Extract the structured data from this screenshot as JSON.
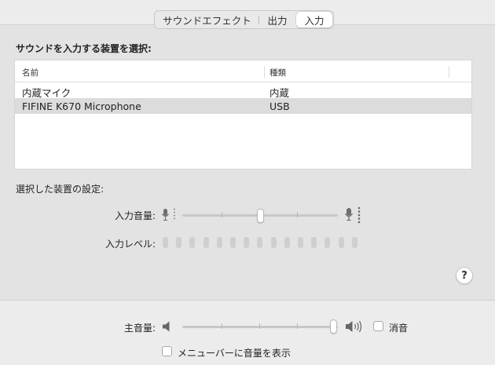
{
  "tabs": [
    {
      "label": "サウンドエフェクト",
      "active": false
    },
    {
      "label": "出力",
      "active": false
    },
    {
      "label": "入力",
      "active": true
    }
  ],
  "input": {
    "section_title": "サウンドを入力する装置を選択:",
    "table": {
      "columns": [
        "名前",
        "種類"
      ],
      "rows": [
        {
          "name": "内蔵マイク",
          "type": "内蔵",
          "selected": false
        },
        {
          "name": "FIFINE K670 Microphone",
          "type": "USB",
          "selected": true
        }
      ]
    },
    "settings_title": "選択した装置の設定:",
    "volume_label": "入力音量:",
    "volume_value": 0.5,
    "level_label": "入力レベル:",
    "level_segments": 15,
    "level_active": 0,
    "help_label": "?"
  },
  "output": {
    "volume_label": "主音量:",
    "volume_value": 1.0,
    "mute_label": "消音",
    "mute_checked": false,
    "menubar_label": "メニューバーに音量を表示",
    "menubar_checked": false
  },
  "colors": {
    "panel_bg": "#e3e3e3",
    "window_bg": "#ececec",
    "selected_row": "#dcdcdc"
  }
}
